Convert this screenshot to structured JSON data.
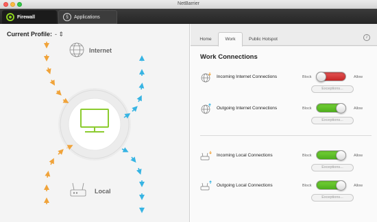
{
  "window": {
    "title": "NetBarrier"
  },
  "toolbar": {
    "tabs": [
      {
        "label": "Firewall",
        "icon": "firewall-icon",
        "selected": true
      },
      {
        "label": "Applications",
        "icon": "applications-icon",
        "selected": false
      }
    ]
  },
  "left": {
    "profile_label": "Current Profile:",
    "profile_value": "-",
    "internet_label": "Internet",
    "local_label": "Local",
    "colors": {
      "incoming": "#f0a33a",
      "outgoing": "#37b4e3",
      "monitor": "#8bcb2d"
    }
  },
  "right": {
    "tabs": [
      {
        "label": "Home",
        "selected": false
      },
      {
        "label": "Work",
        "selected": true
      },
      {
        "label": "Public Hotspot",
        "selected": false
      }
    ],
    "info_icon": "i",
    "section_title": "Work Connections",
    "block_label": "Block",
    "allow_label": "Allow",
    "exceptions_label": "Exceptions...",
    "rows": [
      {
        "label": "Incoming Internet Connections",
        "state": "block",
        "icon": "globe-incoming-icon"
      },
      {
        "label": "Outgoing Internet Connections",
        "state": "allow",
        "icon": "globe-outgoing-icon"
      },
      {
        "label": "Incoming Local Connections",
        "state": "allow",
        "icon": "router-incoming-icon"
      },
      {
        "label": "Outgoing Local Connections",
        "state": "allow",
        "icon": "router-outgoing-icon"
      }
    ]
  }
}
